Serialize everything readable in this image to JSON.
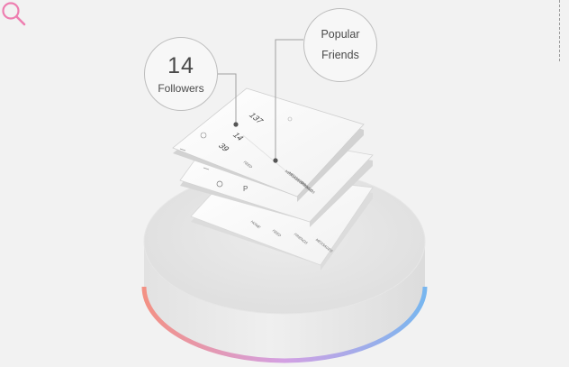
{
  "callouts": {
    "followers_count": "14",
    "followers_label": "Followers",
    "popular_line1": "Popular",
    "popular_line2": "Friends"
  },
  "top_card": {
    "followers": "14",
    "following": "137",
    "posts": "39",
    "tabs": [
      "FEED",
      "MESSAGES",
      "FRIENDS"
    ]
  },
  "middle_card": {
    "tabs": [
      "MESSAGES",
      "FRIENDS"
    ]
  },
  "bottom_card": {
    "tabs": [
      "HOME",
      "FEED",
      "FRIENDS",
      "MESSAGES"
    ]
  },
  "colors": {
    "accent_search": "#ee7eb0",
    "gradient_start": "#f08a7f",
    "gradient_mid": "#c99be0",
    "gradient_end": "#7cb8ee"
  }
}
